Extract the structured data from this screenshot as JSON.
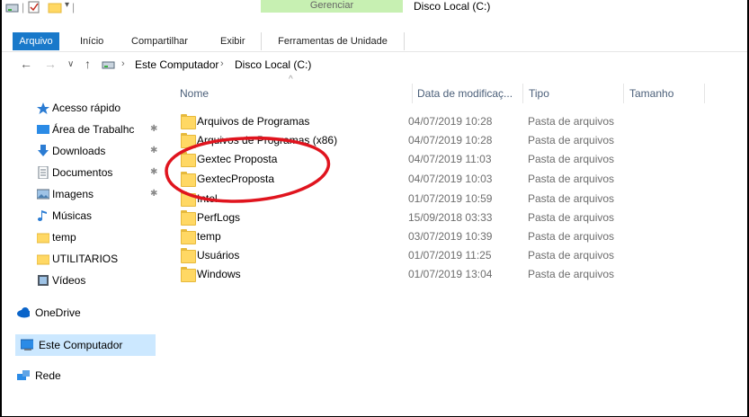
{
  "window": {
    "title": "Disco Local (C:)",
    "context_group": "Gerenciar"
  },
  "ribbon": {
    "tabs": [
      "Arquivo",
      "Início",
      "Compartilhar",
      "Exibir",
      "Ferramentas de Unidade"
    ]
  },
  "address": {
    "crumbs": [
      "Este Computador",
      "Disco Local (C:)"
    ]
  },
  "nav": {
    "items": [
      {
        "label": "Acesso rápido",
        "icon": "star-icon"
      },
      {
        "label": "Área de Trabalhc",
        "icon": "desktop-icon",
        "pinned": true
      },
      {
        "label": "Downloads",
        "icon": "download-icon",
        "pinned": true
      },
      {
        "label": "Documentos",
        "icon": "document-icon",
        "pinned": true
      },
      {
        "label": "Imagens",
        "icon": "image-icon",
        "pinned": true
      },
      {
        "label": "Músicas",
        "icon": "music-icon"
      },
      {
        "label": "temp",
        "icon": "folder-icon"
      },
      {
        "label": "UTILITARIOS",
        "icon": "folder-icon"
      },
      {
        "label": "Vídeos",
        "icon": "video-icon"
      },
      {
        "label": "OneDrive",
        "icon": "cloud-icon"
      },
      {
        "label": "Este Computador",
        "icon": "computer-icon",
        "selected": true
      },
      {
        "label": "Rede",
        "icon": "network-icon"
      }
    ]
  },
  "columns": {
    "name": "Nome",
    "date": "Data de modificaç...",
    "type": "Tipo",
    "size": "Tamanho"
  },
  "files": [
    {
      "name": "Arquivos de Programas",
      "date": "04/07/2019 10:28",
      "type": "Pasta de arquivos"
    },
    {
      "name": "Arquivos de Programas (x86)",
      "date": "04/07/2019 10:28",
      "type": "Pasta de arquivos"
    },
    {
      "name": "Gextec Proposta",
      "date": "04/07/2019 11:03",
      "type": "Pasta de arquivos"
    },
    {
      "name": "GextecProposta",
      "date": "04/07/2019 10:03",
      "type": "Pasta de arquivos"
    },
    {
      "name": "Intel",
      "date": "01/07/2019 10:59",
      "type": "Pasta de arquivos"
    },
    {
      "name": "PerfLogs",
      "date": "15/09/2018 03:33",
      "type": "Pasta de arquivos"
    },
    {
      "name": "temp",
      "date": "03/07/2019 10:39",
      "type": "Pasta de arquivos"
    },
    {
      "name": "Usuários",
      "date": "01/07/2019 11:25",
      "type": "Pasta de arquivos"
    },
    {
      "name": "Windows",
      "date": "01/07/2019 13:04",
      "type": "Pasta de arquivos"
    }
  ],
  "colors": {
    "accent": "#1979ca",
    "context": "#c7f0b2",
    "annotation": "#e0141e",
    "folder": "#ffd864"
  }
}
